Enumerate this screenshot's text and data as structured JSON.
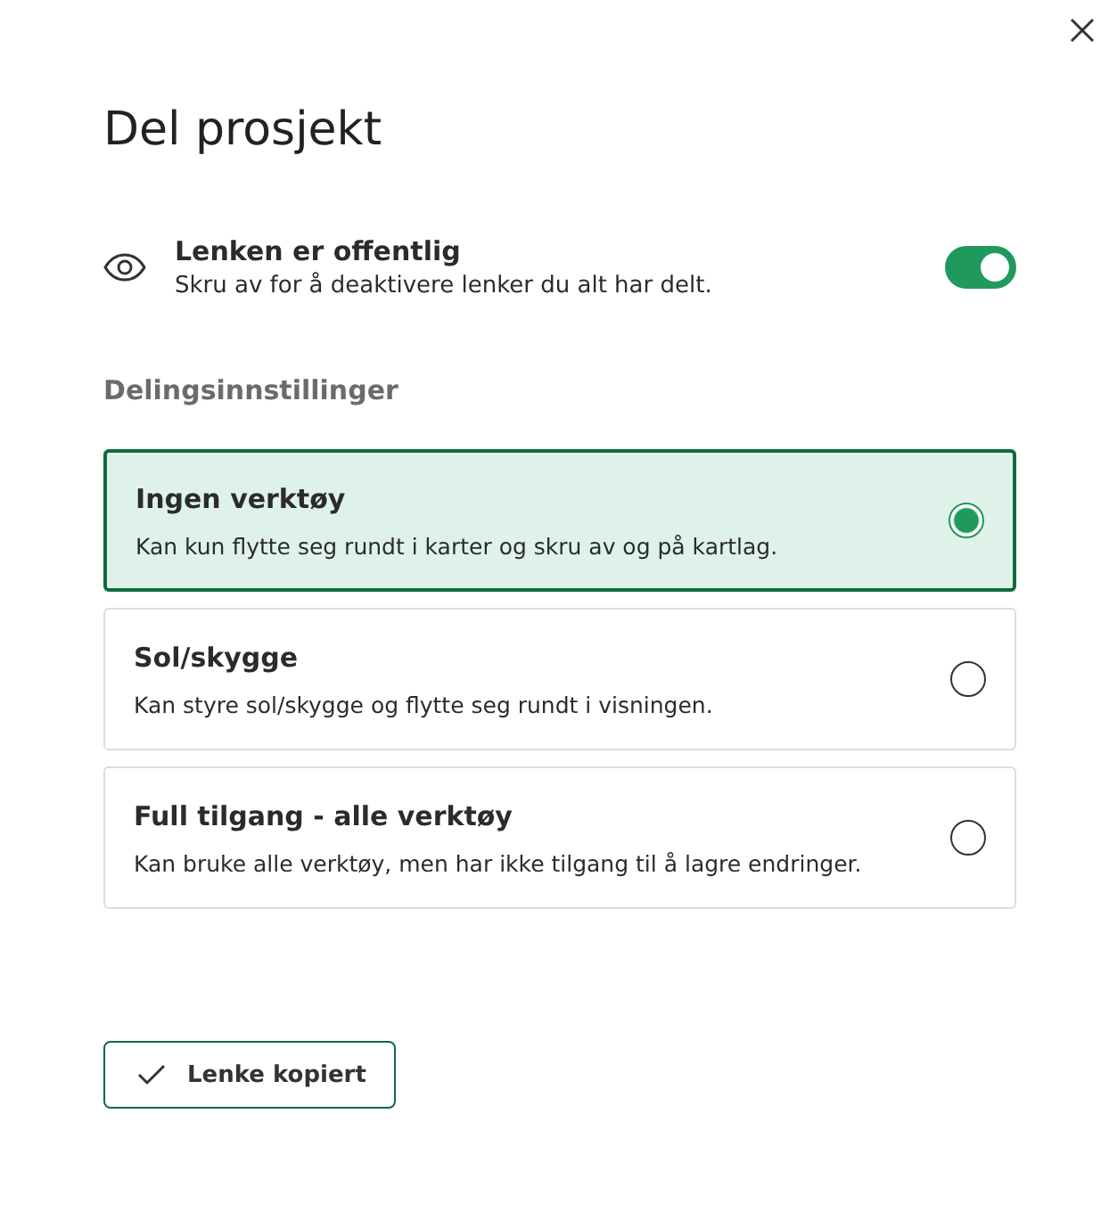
{
  "dialog": {
    "title": "Del prosjekt"
  },
  "public_link": {
    "label": "Lenken er offentlig",
    "description": "Skru av for å deaktivere lenker du alt har delt.",
    "on": true
  },
  "section_title": "Delingsinnstillinger",
  "options": [
    {
      "title": "Ingen verktøy",
      "description": "Kan kun flytte seg rundt i karter og skru av og på kartlag.",
      "selected": true
    },
    {
      "title": "Sol/skygge",
      "description": "Kan styre sol/skygge og flytte seg rundt i visningen.",
      "selected": false
    },
    {
      "title": "Full tilgang - alle verktøy",
      "description": "Kan bruke alle verktøy, men har ikke tilgang til å lagre endringer.",
      "selected": false
    }
  ],
  "copy_button": {
    "label": "Lenke kopiert"
  }
}
